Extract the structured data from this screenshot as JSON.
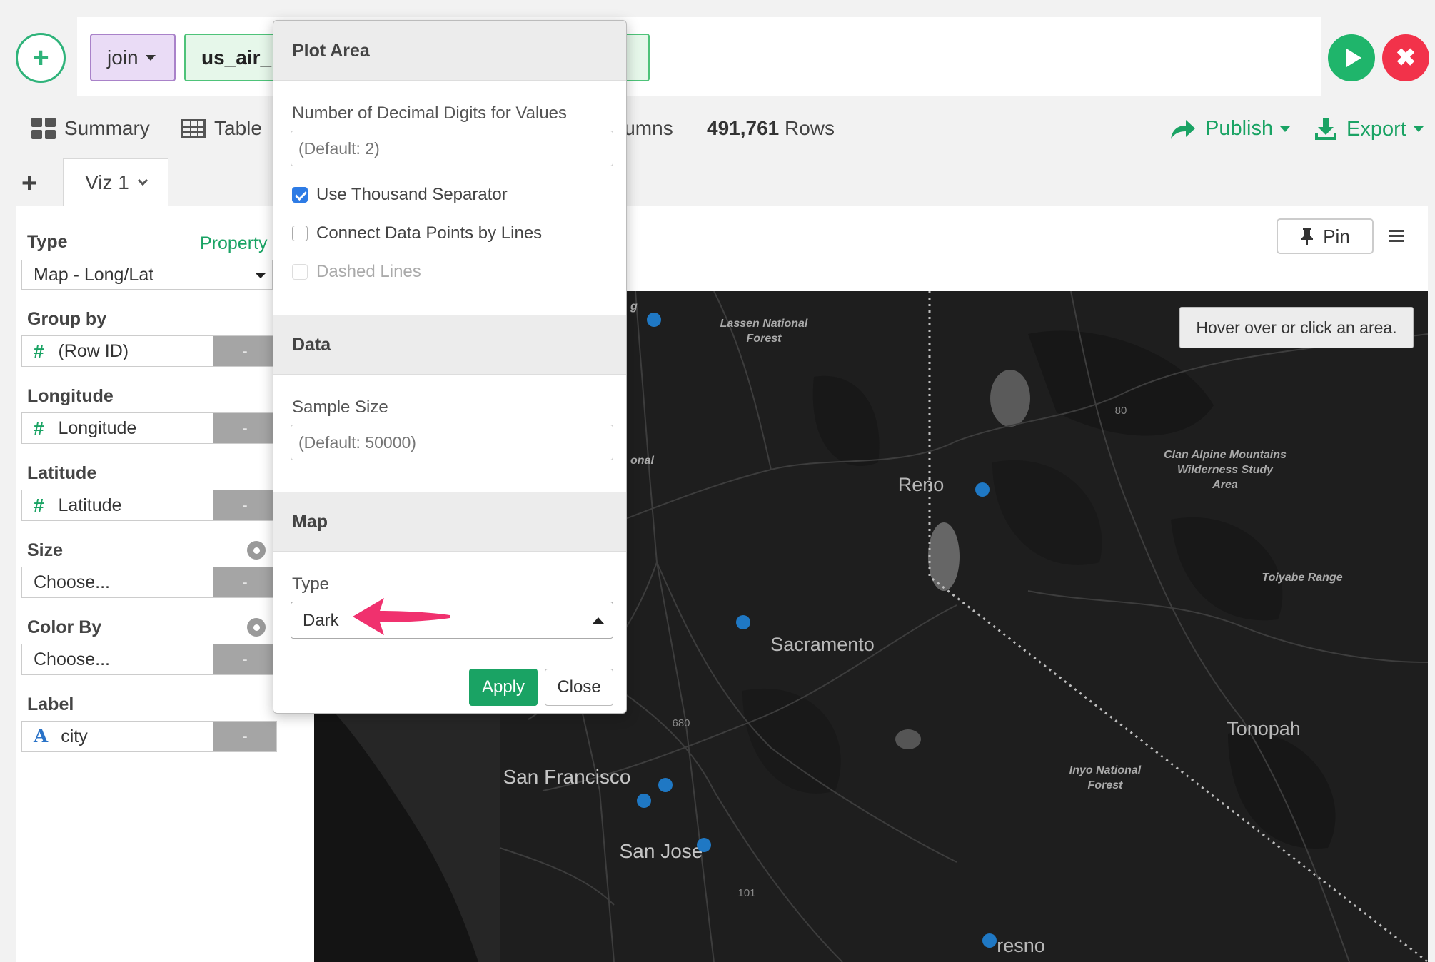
{
  "commandbar": {
    "add_icon": "plus-icon",
    "chip_join": "join",
    "chip_data": "us_air_p",
    "run_icon": "play-icon",
    "cancel_icon": "close-icon"
  },
  "tabs": {
    "summary": "Summary",
    "table": "Table",
    "columns_fragment": "lumns",
    "rows_count": "491,761",
    "rows_label": "Rows",
    "publish": "Publish",
    "export": "Export"
  },
  "viz_tabs": {
    "add": "+",
    "active": "Viz 1"
  },
  "leftpanel": {
    "type_label": "Type",
    "property_link": "Property",
    "type_value": "Map - Long/Lat",
    "group_by_label": "Group by",
    "group_by_value": "(Row ID)",
    "longitude_label": "Longitude",
    "longitude_value": "Longitude",
    "latitude_label": "Latitude",
    "latitude_value": "Latitude",
    "size_label": "Size",
    "size_value": "Choose...",
    "color_by_label": "Color By",
    "color_by_value": "Choose...",
    "label_label": "Label",
    "label_value": "city",
    "remove_symbol": "-",
    "hash_symbol": "#",
    "text_symbol": "A"
  },
  "viz": {
    "pin_label": "Pin",
    "hover_hint": "Hover over or click an area."
  },
  "map": {
    "labels": {
      "lassen": [
        "Lassen National",
        "Forest"
      ],
      "reno": "Reno",
      "clan_alpine": [
        "Clan Alpine Mountains",
        "Wilderness Study",
        "Area"
      ],
      "toiyabe": "Toiyabe Range",
      "sacramento": "Sacramento",
      "tonopah": "Tonopah",
      "inyo": [
        "Inyo National",
        "Forest"
      ],
      "san_francisco": "San Francisco",
      "san_jose": "San Jose",
      "fresno": "resno",
      "onal_fragment": "onal",
      "g_fragment": "g",
      "hwy_80": "80",
      "hwy_680": "680",
      "hwy_101": "101"
    },
    "point_color": "#1f78c4"
  },
  "popup": {
    "plot_area_header": "Plot Area",
    "decimal_label": "Number of Decimal Digits for Values",
    "decimal_placeholder": "(Default: 2)",
    "thousand_sep": "Use Thousand Separator",
    "thousand_sep_checked": true,
    "connect_lines": "Connect Data Points by Lines",
    "connect_lines_checked": false,
    "dashed_lines": "Dashed Lines",
    "data_header": "Data",
    "sample_size_label": "Sample Size",
    "sample_size_placeholder": "(Default: 50000)",
    "map_header": "Map",
    "map_type_label": "Type",
    "map_type_value": "Dark",
    "apply": "Apply",
    "close": "Close"
  },
  "colors": {
    "accent_green": "#1aa364",
    "run_green": "#1fb56b",
    "cancel_red": "#f2324a",
    "annotation_pink": "#f0316e"
  }
}
